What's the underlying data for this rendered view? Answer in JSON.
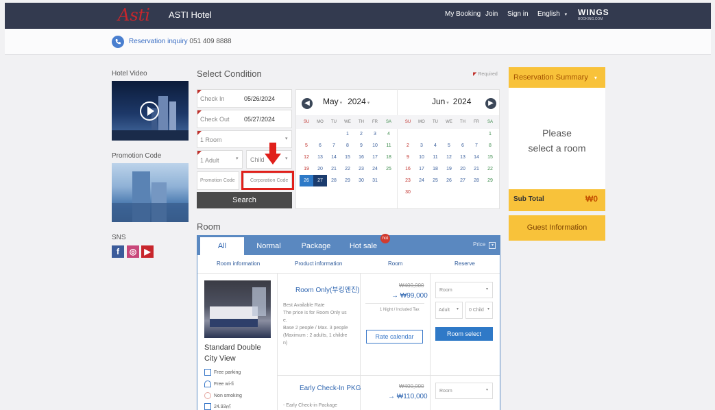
{
  "header": {
    "logo_text": "Asti",
    "hotel_name": "ASTI Hotel",
    "nav": [
      "My Booking",
      "Join",
      "Sign in",
      "English"
    ],
    "brand": "WINGS",
    "brand_sub": "BOOKING.COM"
  },
  "inquiry": {
    "label": "Reservation inquiry",
    "phone": "051 409 8888"
  },
  "left": {
    "video_title": "Hotel Video",
    "promo_title": "Promotion Code",
    "sns_title": "SNS",
    "sns_icons": [
      "facebook-icon",
      "instagram-icon",
      "youtube-icon"
    ]
  },
  "condition": {
    "title": "Select Condition",
    "required": "Required",
    "checkin_label": "Check In",
    "checkin_value": "05/26/2024",
    "checkout_label": "Check Out",
    "checkout_value": "05/27/2024",
    "rooms": "1 Room",
    "adults": "1 Adult",
    "children": "Child",
    "promo_placeholder": "Promotion Code",
    "corp_placeholder": "Corporation Code",
    "search": "Search"
  },
  "calendar": {
    "dow": [
      "SU",
      "MO",
      "TU",
      "WE",
      "TH",
      "FR",
      "SA"
    ],
    "left": {
      "month": "May",
      "year": "2024",
      "weeks": [
        [
          "",
          "",
          "",
          "1",
          "2",
          "3",
          "4"
        ],
        [
          "5",
          "6",
          "7",
          "8",
          "9",
          "10",
          "11"
        ],
        [
          "12",
          "13",
          "14",
          "15",
          "16",
          "17",
          "18"
        ],
        [
          "19",
          "20",
          "21",
          "22",
          "23",
          "24",
          "25"
        ],
        [
          "26",
          "27",
          "28",
          "29",
          "30",
          "31",
          ""
        ]
      ]
    },
    "right": {
      "month": "Jun",
      "year": "2024",
      "weeks": [
        [
          "",
          "",
          "",
          "",
          "",
          "",
          "1"
        ],
        [
          "2",
          "3",
          "4",
          "5",
          "6",
          "7",
          "8"
        ],
        [
          "9",
          "10",
          "11",
          "12",
          "13",
          "14",
          "15"
        ],
        [
          "16",
          "17",
          "18",
          "19",
          "20",
          "21",
          "22"
        ],
        [
          "23",
          "24",
          "25",
          "26",
          "27",
          "28",
          "29"
        ],
        [
          "30",
          "",
          "",
          "",
          "",
          "",
          ""
        ]
      ]
    }
  },
  "summary": {
    "title": "Reservation Summary",
    "message_line1": "Please",
    "message_line2": "select a room",
    "subtotal_label": "Sub Total",
    "subtotal_value": "₩0",
    "guest_btn": "Guest Information"
  },
  "room": {
    "title": "Room",
    "tabs": [
      "All",
      "Normal",
      "Package",
      "Hot sale"
    ],
    "hot_badge": "hot",
    "price_label": "Price",
    "columns": [
      "Room information",
      "Product information",
      "Room",
      "Reserve"
    ],
    "room_name_1": "Standard Double",
    "room_name_2": "City View",
    "amenities": [
      "Free parking",
      "Free wi-fi",
      "Non smoking",
      "24.93㎡"
    ],
    "products": [
      {
        "name": "Room Only(부킹엔진)",
        "desc1": "Best Available Rate",
        "desc2": "The price is for Room Only us",
        "desc3": "e.",
        "desc4": "Base 2 people / Max. 3 people",
        "desc5": "(Maximum : 2 adults, 1 childre",
        "desc6": "n)",
        "old_price": "₩400,000",
        "price": "→ ₩99,000",
        "note": "1 Night / Included Tax",
        "rate_btn": "Rate calendar",
        "room_sel": "Room",
        "adult_sel": "Adult",
        "child_sel": "0 Child",
        "select_btn": "Room select"
      },
      {
        "name": "Early Check-In PKG",
        "desc1": "- Early Check-in Package",
        "old_price": "₩400,000",
        "price": "→ ₩110,000",
        "room_sel": "Room"
      }
    ]
  }
}
